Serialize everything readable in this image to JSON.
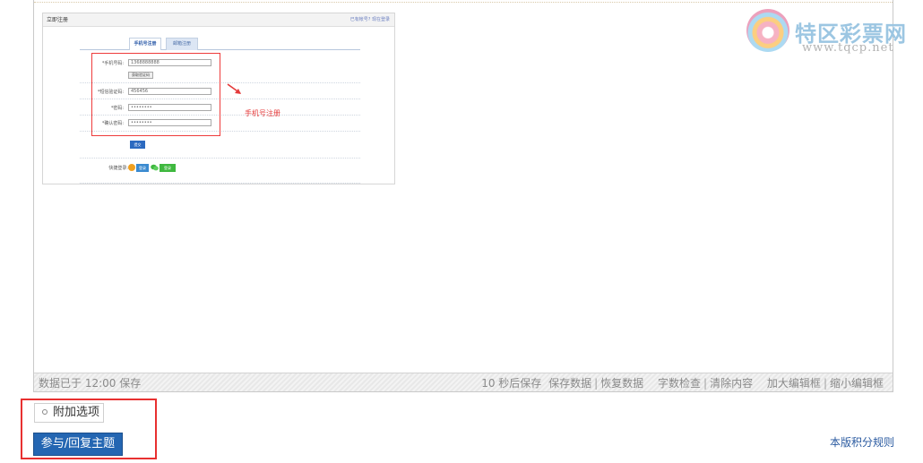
{
  "embedded": {
    "header_title": "立即注册",
    "header_right": "已有帐号? 现在登录",
    "tabs": [
      "手机号注册",
      "邮箱注册"
    ],
    "fields": [
      {
        "label": "*手机号码:",
        "value": "1368888888"
      },
      {
        "label": "*短信验证码:",
        "value": "456456"
      },
      {
        "label": "*密码:",
        "value": "••••••••"
      },
      {
        "label": "*确认密码:",
        "value": "••••••••"
      }
    ],
    "sms_button": "获取验证码",
    "submit": "提交",
    "quick_login_label": "快捷登录:",
    "qq_button": "登录",
    "wechat_button": "登录"
  },
  "annotation": {
    "note": "手机号注册"
  },
  "watermark": {
    "name": "特区彩票网",
    "url": "www.tqcp.net"
  },
  "statusbar": {
    "saved": "数据已于 12:00 保存",
    "autosave": "10 秒后保存",
    "save_data": "保存数据",
    "restore": "恢复数据",
    "word_count": "字数检查",
    "clear": "清除内容",
    "enlarge": "加大编辑框",
    "shrink": "缩小编辑框"
  },
  "bottom": {
    "extra_options": "附加选项",
    "reply_button": "参与/回复主题",
    "rules_link": "本版积分规则"
  },
  "colors": {
    "reply_button": "#2466b2",
    "annotation_red": "#e83030",
    "link": "#2a5aa0"
  }
}
